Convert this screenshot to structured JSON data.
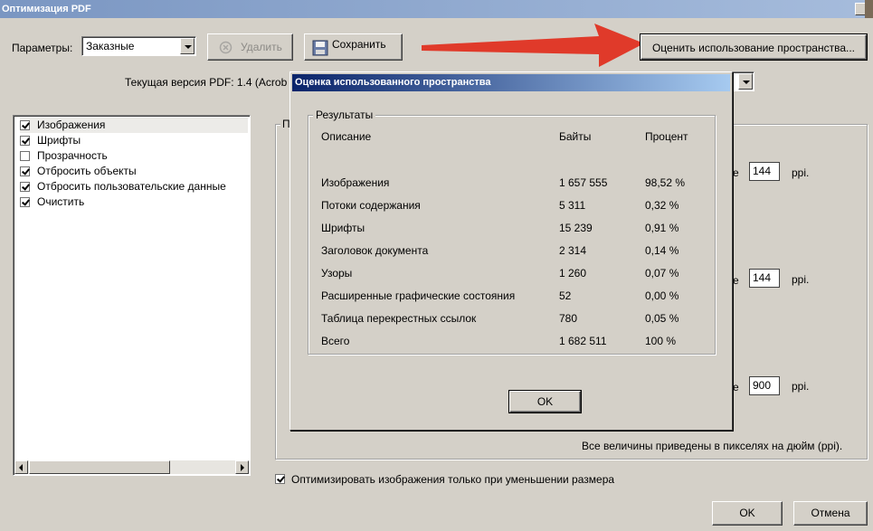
{
  "window": {
    "title": "Оптимизация PDF"
  },
  "toolbar": {
    "params_label": "Параметры:",
    "params_value": "Заказные",
    "delete_label": "Удалить",
    "save_label": "Сохранить",
    "estimate_label": "Оценить использование пространства..."
  },
  "version_label": "Текущая версия PDF: 1.4 (Acrob",
  "sidebar": {
    "items": [
      {
        "label": "Изображения",
        "checked": true,
        "selected": true
      },
      {
        "label": "Шрифты",
        "checked": true,
        "selected": false
      },
      {
        "label": "Прозрачность",
        "checked": false,
        "selected": false
      },
      {
        "label": "Отбросить объекты",
        "checked": true,
        "selected": false
      },
      {
        "label": "Отбросить пользовательские данные",
        "checked": true,
        "selected": false
      },
      {
        "label": "Очистить",
        "checked": true,
        "selected": false
      }
    ]
  },
  "panel": {
    "group_prefix": "П",
    "rows": [
      {
        "prefix": "е",
        "value": "144",
        "unit": "ppi."
      },
      {
        "prefix": "е",
        "value": "144",
        "unit": "ppi."
      },
      {
        "prefix": "е",
        "value": "900",
        "unit": "ppi."
      }
    ],
    "note": "Все величины приведены в пикселях на дюйм (ppi)."
  },
  "optimize_only": {
    "label": "Оптимизировать изображения только при уменьшении размера",
    "checked": true
  },
  "footer": {
    "ok_label": "OK",
    "cancel_label": "Отмена"
  },
  "dialog": {
    "title": "Оценка использованного пространства",
    "group_label": "Результаты",
    "headers": {
      "description": "Описание",
      "bytes": "Байты",
      "percent": "Процент"
    },
    "rows": [
      {
        "description": "Изображения",
        "bytes": "1 657 555",
        "percent": "98,52 %"
      },
      {
        "description": "Потоки содержания",
        "bytes": "5 311",
        "percent": "0,32 %"
      },
      {
        "description": "Шрифты",
        "bytes": "15 239",
        "percent": "0,91 %"
      },
      {
        "description": "Заголовок документа",
        "bytes": "2 314",
        "percent": "0,14 %"
      },
      {
        "description": "Узоры",
        "bytes": "1 260",
        "percent": "0,07 %"
      },
      {
        "description": "Расширенные графические состояния",
        "bytes": "52",
        "percent": "0,00 %"
      },
      {
        "description": "Таблица перекрестных ссылок",
        "bytes": "780",
        "percent": "0,05 %"
      },
      {
        "description": "Всего",
        "bytes": "1 682 511",
        "percent": "100 %"
      }
    ],
    "ok_label": "OK"
  },
  "icons": {
    "delete": "cancel-circle-icon",
    "save": "floppy-disk-icon",
    "arrow": "red-arrow-icon"
  },
  "colors": {
    "arrow": "#e03a2a",
    "dialog_title": "#0a246a",
    "window_title": "#7a96c2"
  }
}
